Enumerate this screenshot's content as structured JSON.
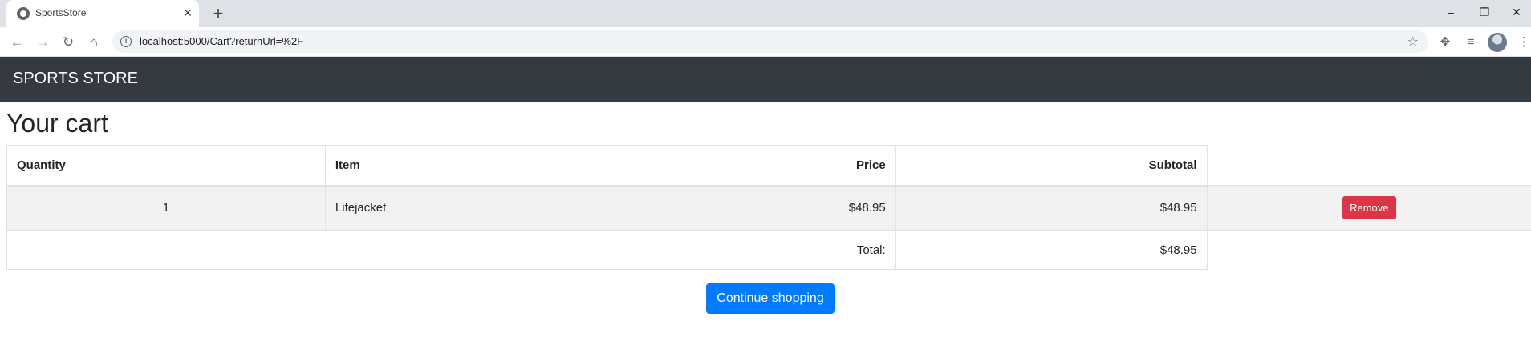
{
  "browser": {
    "tab_title": "SportsStore",
    "url": "localhost:5000/Cart?returnUrl=%2F"
  },
  "navbar": {
    "brand": "SPORTS STORE"
  },
  "page": {
    "title": "Your cart"
  },
  "cart": {
    "headers": {
      "quantity": "Quantity",
      "item": "Item",
      "price": "Price",
      "subtotal": "Subtotal"
    },
    "rows": [
      {
        "quantity": "1",
        "item": "Lifejacket",
        "price": "$48.95",
        "subtotal": "$48.95",
        "remove_label": "Remove"
      }
    ],
    "total_label": "Total:",
    "total_value": "$48.95"
  },
  "actions": {
    "continue_label": "Continue shopping"
  },
  "colors": {
    "navbar": "#343a40",
    "primary": "#007bff",
    "danger": "#dc3545"
  }
}
